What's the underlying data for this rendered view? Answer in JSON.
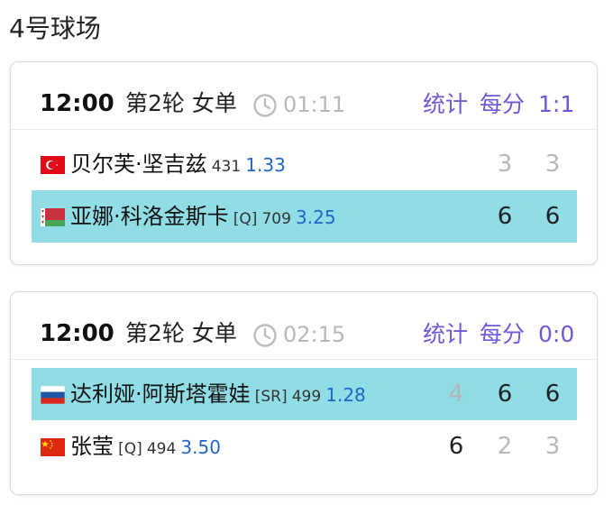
{
  "court": {
    "title": "4号球场"
  },
  "matches": [
    {
      "time": "12:00",
      "round": "第2轮 女单",
      "duration": "01:11",
      "links": {
        "stats": "统计",
        "pbp": "每分",
        "h2h": "1:1"
      },
      "players": [
        {
          "flag": "turkey-flag",
          "name": "贝尔芙·坚吉兹",
          "seed": "",
          "rank": "431",
          "odds": "1.33",
          "scores": [
            "",
            "3",
            "3"
          ],
          "highlight": false
        },
        {
          "flag": "belarus-flag",
          "name": "亚娜·科洛金斯卡",
          "seed": "[Q]",
          "rank": "709",
          "odds": "3.25",
          "scores": [
            "",
            "6",
            "6"
          ],
          "highlight": true
        }
      ]
    },
    {
      "time": "12:00",
      "round": "第2轮 女单",
      "duration": "02:15",
      "links": {
        "stats": "统计",
        "pbp": "每分",
        "h2h": "0:0"
      },
      "players": [
        {
          "flag": "russia-flag",
          "name": "达利娅·阿斯塔霍娃",
          "seed": "[SR]",
          "rank": "499",
          "odds": "1.28",
          "scores": [
            "4",
            "6",
            "6"
          ],
          "highlight": true
        },
        {
          "flag": "china-flag",
          "name": "张莹",
          "seed": "[Q]",
          "rank": "494",
          "odds": "3.50",
          "scores": [
            "6",
            "2",
            "3"
          ],
          "highlight": false
        }
      ]
    }
  ],
  "colors": {
    "highlight": "#90dde6",
    "link": "#6d59d8",
    "odds": "#1f66c9",
    "muted": "#b9b9b9"
  }
}
